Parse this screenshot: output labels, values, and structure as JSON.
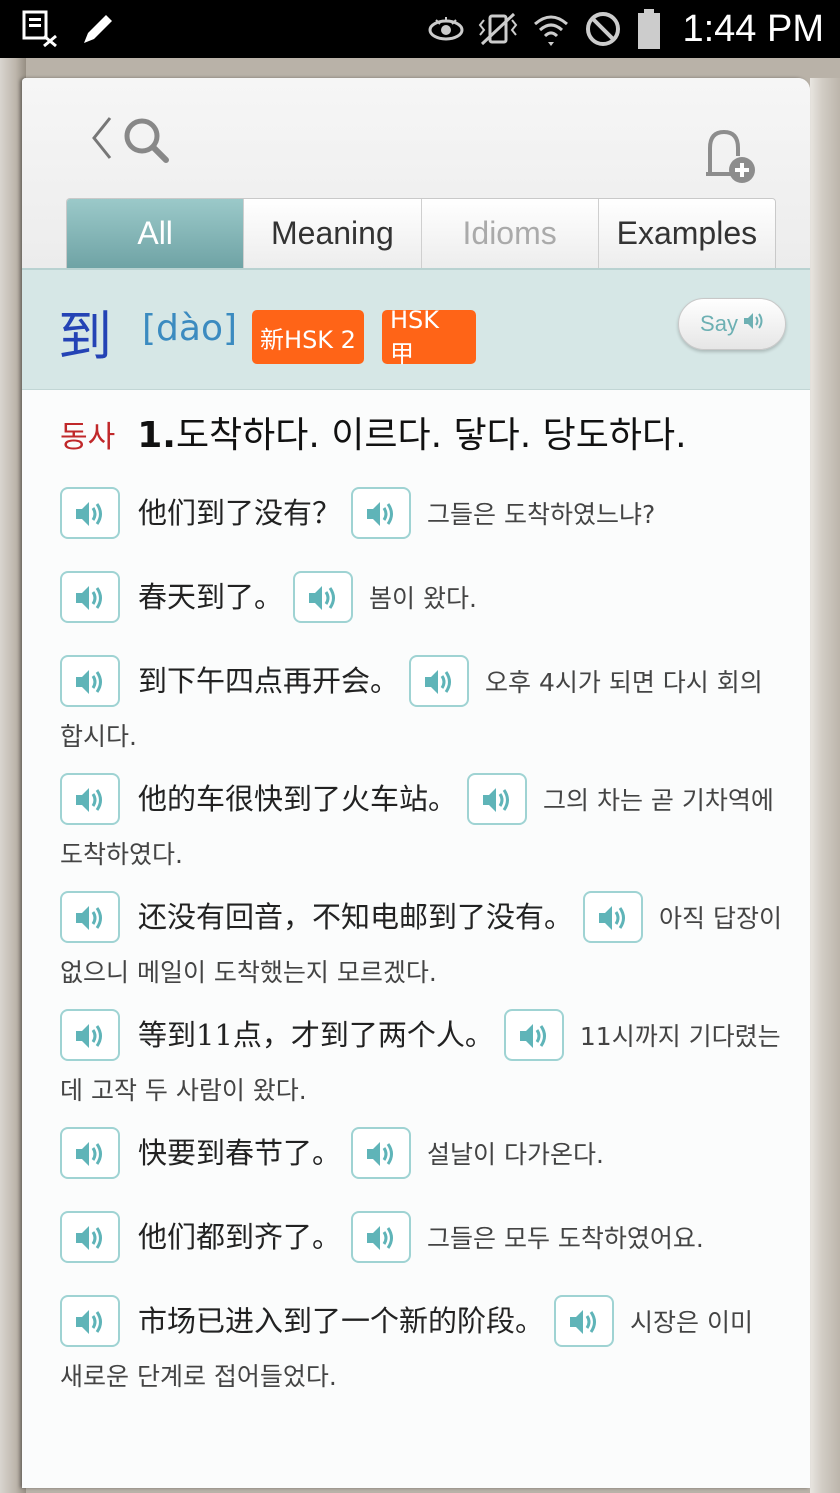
{
  "status_bar": {
    "time": "1:44 PM",
    "icons": [
      "dictionary-notification-icon",
      "edit-icon",
      "eye-icon",
      "vibrate-icon",
      "wifi-icon",
      "block-icon",
      "battery-icon"
    ]
  },
  "toolbar": {
    "back_icon": "chevron-left-icon",
    "search_icon": "search-icon",
    "bookmark_icon": "bookmark-add-icon"
  },
  "tabs": [
    {
      "label": "All",
      "state": "active"
    },
    {
      "label": "Meaning",
      "state": "normal"
    },
    {
      "label": "Idioms",
      "state": "disabled"
    },
    {
      "label": "Examples",
      "state": "normal"
    }
  ],
  "entry": {
    "headword": "到",
    "pinyin": "[dào]",
    "badges": [
      "新HSK 2",
      "HSK 甲"
    ],
    "say_label": "Say"
  },
  "definition": {
    "pos": "동사",
    "number": "1.",
    "text": "도착하다. 이르다. 닿다. 당도하다."
  },
  "examples": [
    {
      "zh": "他们到了没有？",
      "ko": "그들은 도착하였느냐?"
    },
    {
      "zh": "春天到了。",
      "ko": "봄이 왔다."
    },
    {
      "zh": "到下午四点再开会。",
      "ko": "오후 4시가 되면 다시 회의합시다."
    },
    {
      "zh": "他的车很快到了火车站。",
      "ko": "그의 차는 곧 기차역에 도착하였다."
    },
    {
      "zh": "还没有回音，不知电邮到了没有。",
      "ko": "아직 답장이 없으니 메일이 도착했는지 모르겠다."
    },
    {
      "zh": "等到11点，才到了两个人。",
      "ko": "11시까지 기다렸는데 고작 두 사람이 왔다."
    },
    {
      "zh": "快要到春节了。",
      "ko": "설날이 다가온다."
    },
    {
      "zh": "他们都到齐了。",
      "ko": "그들은 모두 도착하였어요."
    },
    {
      "zh": "市场已进入到了一个新的阶段。",
      "ko": "시장은 이미 새로운 단계로 접어들었다."
    }
  ],
  "colors": {
    "accent": "#6fa3a5",
    "badge": "#ff6417",
    "headword": "#2443b5",
    "pinyin": "#3b8bc0",
    "pos": "#c0282a"
  }
}
